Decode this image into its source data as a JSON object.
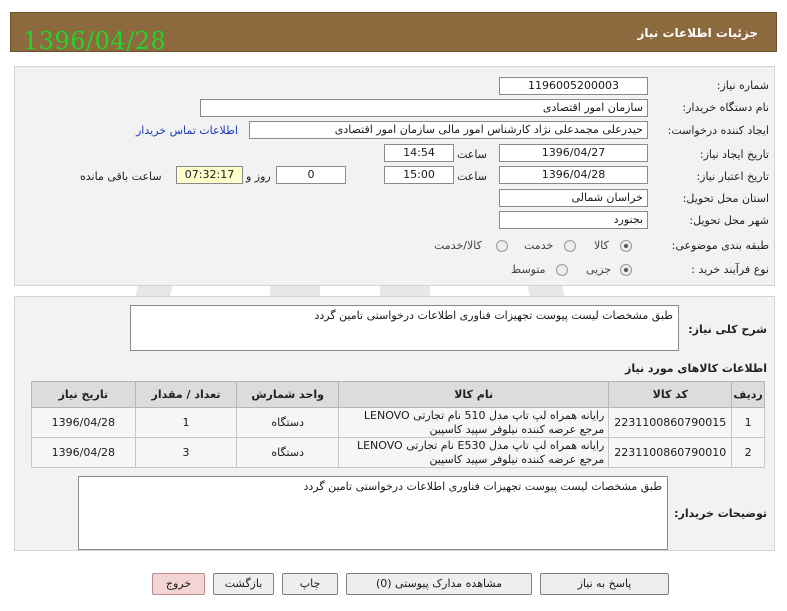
{
  "header": {
    "title": "جزئیات اطلاعات نیاز",
    "date": "1396/04/28"
  },
  "form": {
    "need_number": {
      "label": "شماره نیاز:",
      "value": "1196005200003"
    },
    "buyer_org": {
      "label": "نام دستگاه خریدار:",
      "value": "سازمان امور اقتصادی"
    },
    "requester": {
      "label": "ایجاد کننده درخواست:",
      "value": "حیدرعلی مجمدعلی نژاد کارشناس امور مالی  سازمان امور اقتصادی",
      "contact_link": "اطلاعات تماس خریدار"
    },
    "created": {
      "label": "تاریخ ایجاد نیاز:",
      "date": "1396/04/27",
      "time_label": "ساعت",
      "time": "14:54"
    },
    "validity": {
      "label": "تاریخ اعتبار نیاز:",
      "date": "1396/04/28",
      "time_label": "ساعت",
      "time": "15:00",
      "days": "0",
      "days_label": "روز و",
      "remaining": "07:32:17",
      "remaining_label": "ساعت باقی مانده"
    },
    "province": {
      "label": "استان محل تحویل:",
      "value": "خراسان شمالی"
    },
    "city": {
      "label": "شهر محل تحویل:",
      "value": "بجنورد"
    },
    "category": {
      "label": "طبقه بندی موضوعی:",
      "options": [
        "کالا",
        "خدمت",
        "کالا/خدمت"
      ],
      "selected": "کالا"
    },
    "process": {
      "label": "نوع فرآیند خرید :",
      "options": [
        "جزیی",
        "متوسط"
      ],
      "selected": "جزیی"
    }
  },
  "summary": {
    "label": "شرح کلی نیاز:",
    "text": "طبق مشخصات لیست پیوست تجهیزات فناوری اطلاعات درخواستی تامین گردد"
  },
  "items": {
    "title": "اطلاعات کالاهای مورد نیاز",
    "columns": [
      "ردیف",
      "کد کالا",
      "نام کالا",
      "واحد شمارش",
      "تعداد / مقدار",
      "تاریخ نیاز"
    ],
    "rows": [
      {
        "row": "1",
        "code": "2231100860790015",
        "name": "رایانه همراه لپ تاپ مدل 510 نام تجارتی LENOVO مرجع عرضه کننده نیلوفر سپید کاسپین",
        "unit": "دستگاه",
        "qty": "1",
        "date": "1396/04/28"
      },
      {
        "row": "2",
        "code": "2231100860790010",
        "name": "رایانه همراه لپ تاپ مدل E530 نام تجارتی LENOVO مرجع عرضه کننده نیلوفر سپید کاسپین",
        "unit": "دستگاه",
        "qty": "3",
        "date": "1396/04/28"
      }
    ]
  },
  "buyer_notes": {
    "label": "توضیحات خریدار:",
    "text": "طبق مشخصات لیست پیوست تجهیزات فناوری اطلاعات درخواستی تامین گردد"
  },
  "buttons": {
    "reply": "پاسخ به نیاز",
    "attachments": "مشاهده مدارک پیوستی (0)",
    "print": "چاپ",
    "back": "بازگشت",
    "exit": "خروج"
  },
  "colors": {
    "header_bg": "#8c6a3e",
    "header_date": "#22d52a",
    "link": "#1a3bb8"
  }
}
